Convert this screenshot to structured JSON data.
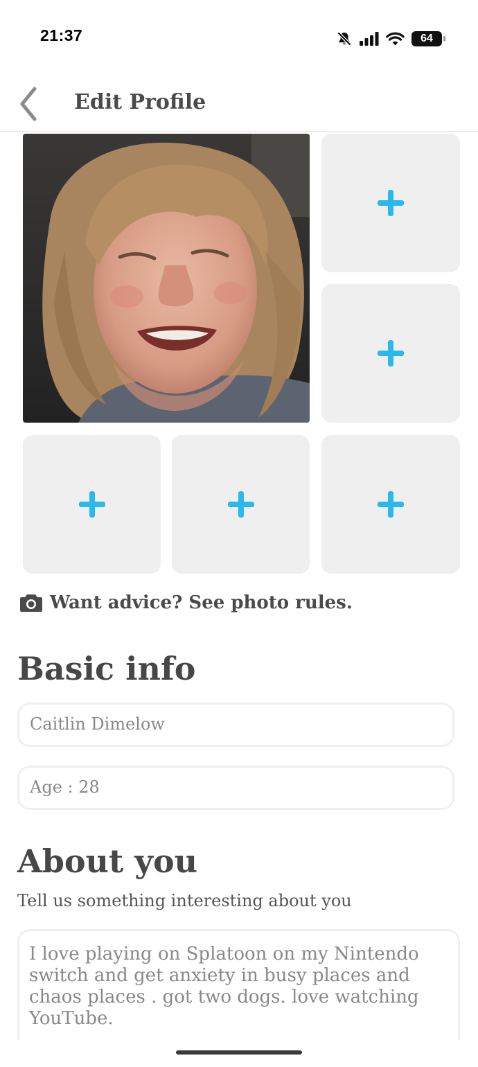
{
  "status_bar": {
    "time": "21:37",
    "battery_level": "64",
    "icons": [
      "bell-slash-icon",
      "cellular-signal-icon",
      "wifi-icon",
      "battery-icon"
    ]
  },
  "header": {
    "title": "Edit Profile",
    "back_icon": "chevron-left-icon"
  },
  "photos": {
    "main_photo": "profile-photo",
    "empty_slots": 5,
    "add_icon": "plus-icon",
    "accent_color": "#2bb8ea"
  },
  "photo_rules": {
    "icon": "camera-icon",
    "text": "Want advice? See photo rules."
  },
  "basic_info": {
    "title": "Basic info",
    "name_value": "Caitlin Dimelow",
    "age_value": "Age : 28"
  },
  "about": {
    "title": "About you",
    "subtitle": "Tell us something interesting about you",
    "bio_value": "I love playing on Splatoon  on my Nintendo switch  and get anxiety in busy places and chaos places . got two dogs. love watching YouTube."
  }
}
